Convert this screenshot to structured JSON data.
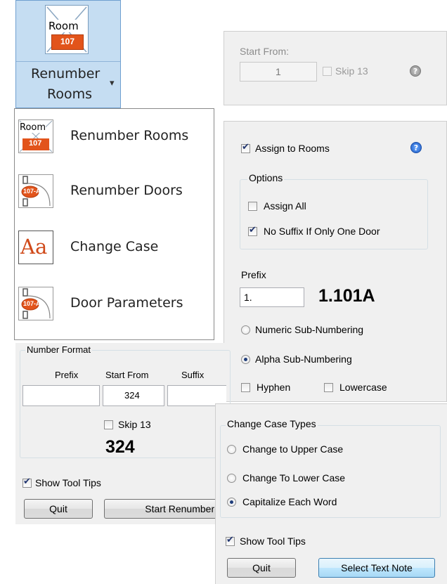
{
  "ribbon": {
    "icon_room_text": "Room",
    "icon_number_text": "107",
    "label_line1": "Renumber",
    "label_line2": "Rooms",
    "dropdown_glyph": "▾"
  },
  "menu": {
    "items": [
      {
        "label": "Renumber Rooms",
        "icon": "room-icon",
        "icon_text_top": "Room",
        "icon_text_bottom": "107"
      },
      {
        "label": "Renumber Doors",
        "icon": "door-icon",
        "icon_text": "107-A"
      },
      {
        "label": "Change Case",
        "icon": "change-case-icon",
        "icon_text": "Aa"
      },
      {
        "label": "Door Parameters",
        "icon": "door-parameters-icon",
        "icon_text": "107-A"
      }
    ]
  },
  "top_right": {
    "start_from_label": "Start From:",
    "start_from_value": "1",
    "skip13_label": "Skip 13",
    "help_glyph": "?"
  },
  "door_panel": {
    "assign_to_rooms_label": "Assign to Rooms",
    "help_glyph": "?",
    "options_title": "Options",
    "assign_all_label": "Assign All",
    "no_suffix_label": "No Suffix If Only One Door",
    "prefix_label": "Prefix",
    "prefix_value": "1.",
    "preview": "1.101A",
    "numeric_sub_label": "Numeric Sub-Numbering",
    "alpha_sub_label": "Alpha Sub-Numbering",
    "hyphen_label": "Hyphen",
    "lowercase_label": "Lowercase"
  },
  "number_format": {
    "title": "Number Format",
    "prefix_header": "Prefix",
    "start_from_header": "Start From",
    "suffix_header": "Suffix",
    "start_from_value": "324",
    "skip13_label": "Skip 13",
    "preview": "324",
    "show_tool_tips_label": "Show Tool Tips",
    "quit_label": "Quit",
    "start_renumbering_label": "Start Renumberin"
  },
  "change_case": {
    "title": "Change Case Types",
    "upper_label": "Change to Upper Case",
    "lower_label": "Change To Lower Case",
    "capitalize_label": "Capitalize Each Word",
    "show_tool_tips_label": "Show Tool Tips",
    "quit_label": "Quit",
    "select_text_note_label": "Select Text Note"
  },
  "colors": {
    "ribbon_bg": "#c5ddf2",
    "ribbon_border": "#6f9fd0",
    "help_blue": "#2a6fd6",
    "help_gray": "#9a9a9a",
    "room_icon_orange": "#e2541b"
  }
}
